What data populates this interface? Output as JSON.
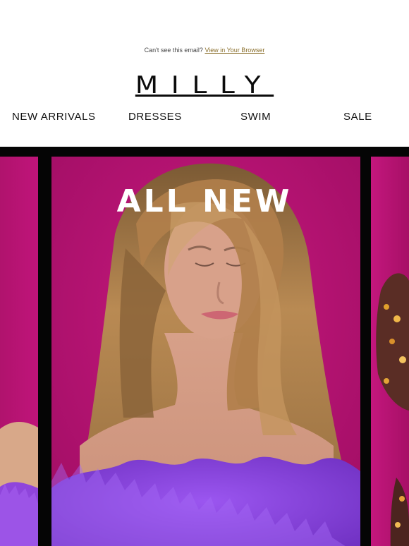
{
  "preheader": {
    "text": "Can't see this email?",
    "link_label": "View in Your Browser"
  },
  "brand": {
    "logo": "MILLY"
  },
  "nav": {
    "items": [
      "NEW ARRIVALS",
      "DRESSES",
      "SWIM",
      "SALE"
    ]
  },
  "hero": {
    "heading": "ALL NEW",
    "colors": {
      "magenta_bg": "#b3126f",
      "frame_black": "#050505",
      "feather_purple": "#8a43d9",
      "hair_brown": "#b98a53"
    }
  },
  "icons": {
    "model_image": "fashion-model-image"
  }
}
